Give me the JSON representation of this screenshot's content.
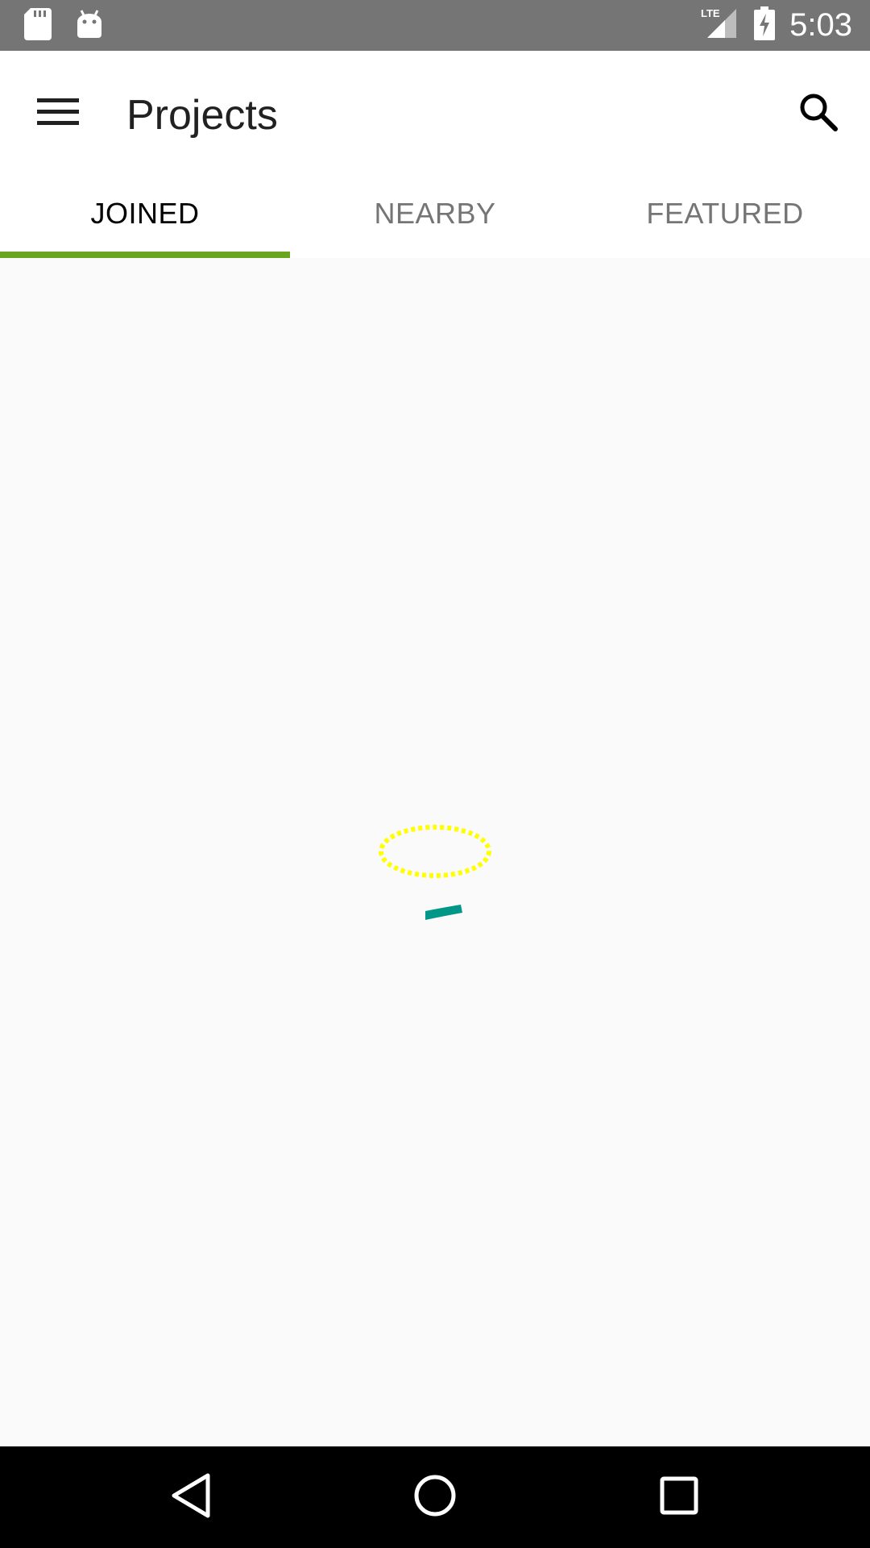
{
  "status_bar": {
    "time": "5:03",
    "network": "LTE",
    "icons": [
      "sd-card-icon",
      "android-icon",
      "lte-signal-icon",
      "battery-charging-icon"
    ]
  },
  "toolbar": {
    "title": "Projects",
    "menu_icon": "hamburger-menu-icon",
    "search_icon": "search-icon"
  },
  "tabs": [
    {
      "label": "JOINED",
      "active": true
    },
    {
      "label": "NEARBY",
      "active": false
    },
    {
      "label": "FEATURED",
      "active": false
    }
  ],
  "colors": {
    "status_bar": "#757575",
    "tab_indicator": "#6aa51f",
    "spinner_ring": "#ffff00",
    "spinner_arc": "#009688",
    "background": "#fafafa"
  },
  "navigation_bar": {
    "buttons": [
      "back-icon",
      "home-icon",
      "recents-icon"
    ]
  }
}
